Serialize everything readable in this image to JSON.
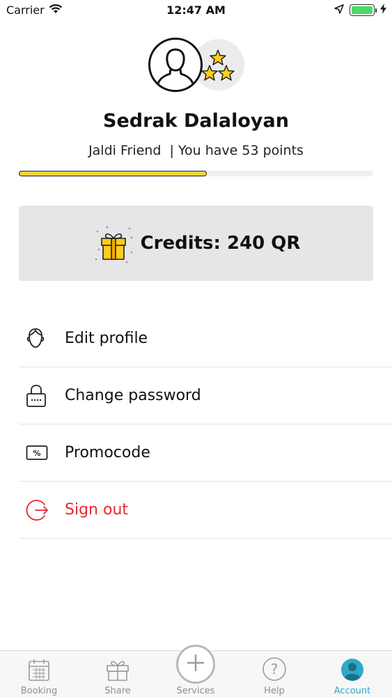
{
  "status_bar": {
    "carrier": "Carrier",
    "time": "12:47 AM"
  },
  "profile": {
    "name": "Sedrak Dalaloyan",
    "subtitle": "Jaldi Friend  | You have 53 points",
    "points_progress": 0.53
  },
  "credits": {
    "label": "Credits: 240 QR"
  },
  "menu": {
    "items": [
      {
        "label": "Edit profile",
        "icon": "face-outline-icon"
      },
      {
        "label": "Change password",
        "icon": "lock-icon"
      },
      {
        "label": "Promocode",
        "icon": "percent-ticket-icon"
      },
      {
        "label": "Sign out",
        "icon": "sign-out-icon"
      }
    ]
  },
  "tab_bar": {
    "tabs": [
      {
        "label": "Booking",
        "icon": "calendar-icon"
      },
      {
        "label": "Share",
        "icon": "gift-icon"
      },
      {
        "label": "Services",
        "icon": "plus-icon"
      },
      {
        "label": "Help",
        "icon": "question-icon"
      },
      {
        "label": "Account",
        "icon": "account-icon"
      }
    ],
    "active": "Account"
  },
  "colors": {
    "accent": "#2fa8c9",
    "progress": "#f7d33a",
    "danger": "#e8262f",
    "card_bg": "#e6e6e8"
  }
}
